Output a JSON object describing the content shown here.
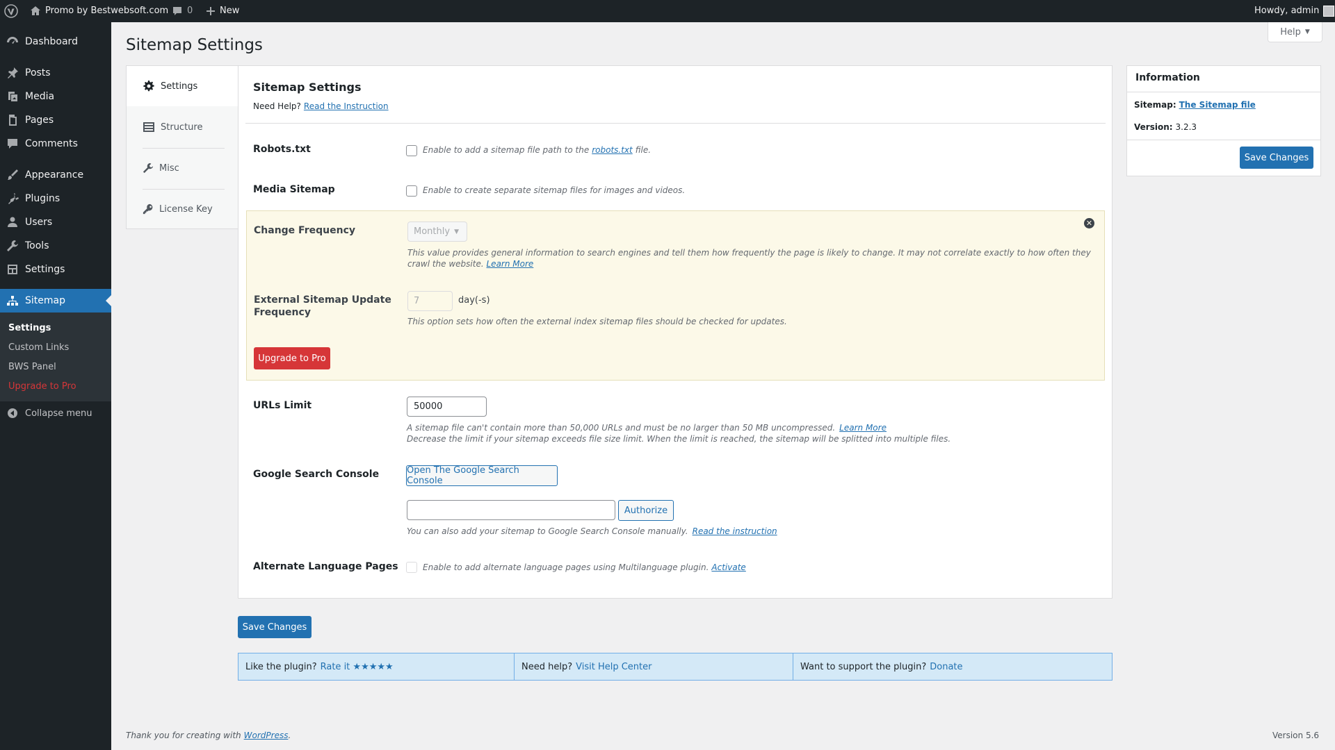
{
  "adminbar": {
    "site_name": "Promo by Bestwebsoft.com",
    "comments_count": "0",
    "new_label": "New",
    "howdy": "Howdy, admin"
  },
  "sidebar": {
    "items": [
      {
        "label": "Dashboard",
        "icon": "dashboard-icon"
      },
      {
        "label": "Posts",
        "icon": "pin-icon"
      },
      {
        "label": "Media",
        "icon": "media-icon"
      },
      {
        "label": "Pages",
        "icon": "page-icon"
      },
      {
        "label": "Comments",
        "icon": "comment-icon"
      },
      {
        "label": "Appearance",
        "icon": "brush-icon"
      },
      {
        "label": "Plugins",
        "icon": "plugin-icon"
      },
      {
        "label": "Users",
        "icon": "user-icon"
      },
      {
        "label": "Tools",
        "icon": "wrench-icon"
      },
      {
        "label": "Settings",
        "icon": "settings-icon"
      },
      {
        "label": "Sitemap",
        "icon": "sitemap-icon"
      }
    ],
    "submenu": [
      "Settings",
      "Custom Links",
      "BWS Panel",
      "Upgrade to Pro"
    ],
    "collapse": "Collapse menu"
  },
  "page": {
    "title": "Sitemap Settings",
    "help": "Help"
  },
  "tabs": [
    "Settings",
    "Structure",
    "Misc",
    "License Key"
  ],
  "main": {
    "heading": "Sitemap Settings",
    "need_help": "Need Help?",
    "read_instruction": "Read the Instruction",
    "robots_label": "Robots.txt",
    "robots_desc_pre": "Enable to add a sitemap file path to the",
    "robots_link": "robots.txt",
    "robots_desc_post": "file.",
    "media_label": "Media Sitemap",
    "media_desc": "Enable to create separate sitemap files for images and videos.",
    "freq_label": "Change Frequency",
    "freq_value": "Monthly",
    "freq_desc": "This value provides general information to search engines and tell them how frequently the page is likely to change. It may not correlate exactly to how often they crawl the website.",
    "freq_learn": "Learn More",
    "ext_label": "External Sitemap Update Frequency",
    "ext_value": "7",
    "ext_unit": "day(-s)",
    "ext_desc": "This option sets how often the external index sitemap files should be checked for updates.",
    "upgrade_btn": "Upgrade to Pro",
    "urls_label": "URLs Limit",
    "urls_value": "50000",
    "urls_desc1": "A sitemap file can't contain more than 50,000 URLs and must be no larger than 50 MB uncompressed.",
    "urls_learn": "Learn More",
    "urls_desc2": "Decrease the limit if your sitemap exceeds file size limit. When the limit is reached, the sitemap will be splitted into multiple files.",
    "gsc_label": "Google Search Console",
    "gsc_open": "Open The Google Search Console",
    "authorize": "Authorize",
    "gsc_desc": "You can also add your sitemap to Google Search Console manually.",
    "gsc_link": "Read the instruction",
    "alt_label": "Alternate Language Pages",
    "alt_desc": "Enable to add alternate language pages using Multilanguage plugin.",
    "alt_link": "Activate",
    "save": "Save Changes"
  },
  "info": {
    "title": "Information",
    "sitemap_label": "Sitemap:",
    "sitemap_link": "The Sitemap file",
    "version_label": "Version:",
    "version_value": "3.2.3",
    "save": "Save Changes"
  },
  "footer_bar": {
    "like": "Like the plugin?",
    "rate": "Rate it",
    "stars": "★★★★★",
    "need_help": "Need help?",
    "help_center": "Visit Help Center",
    "support": "Want to support the plugin?",
    "donate": "Donate"
  },
  "footer": {
    "thanks": "Thank you for creating with",
    "wp_link": "WordPress",
    "version": "Version 5.6"
  },
  "colors": {
    "accent": "#2271b1",
    "upgrade": "#d63638",
    "sidebar_bg": "#1d2327",
    "pro_box_bg": "#fcf9e8"
  }
}
